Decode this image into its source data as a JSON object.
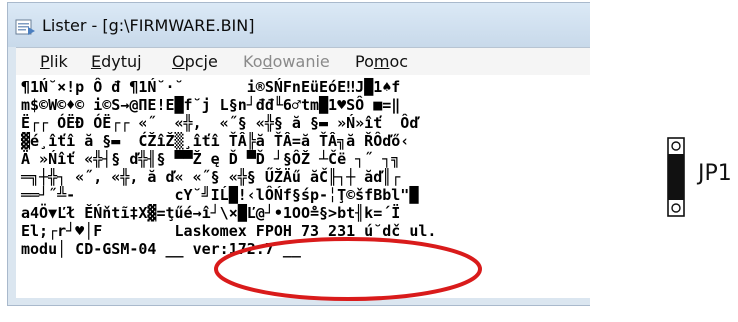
{
  "window": {
    "title": "Lister - [g:\\FIRMWARE.BIN]"
  },
  "menu": {
    "items": [
      {
        "label": "Plik",
        "enabled": true
      },
      {
        "label": "Edytuj",
        "enabled": true
      },
      {
        "label": "Opcje",
        "enabled": true
      },
      {
        "label": "Kodowanie",
        "enabled": false
      },
      {
        "label": "Pomoc",
        "enabled": true
      }
    ]
  },
  "content": {
    "lines": [
      "¶1Ń˘×!p Ô đ ¶1Ń˘·˘       i®SŃFnEüEóE‼J█1♠f",
      "m$©W©♦© i©S→@ΠE!E█f˘j L§n┘đđ╙6♂tm█1♥SÔ ■=‖",
      "Ë┌┌ ÓËĐ ÓË┌┌ «˝  «╬,  «˝§ «╬§ ă §▬ »Ń»îť  Ôď",
      "▓é¸îťî ă §▬  ĆŽîŽ▒¸îťî ŤÂ╠ă ŤÂ=ă ŤÂ╗ă ŘÔďő‹",
      "Ä »Ńîť «╬┤§ ď╬╢§ ▀▀Ž ę Ď ▀Ď ┘§ÔŽ ┴Čë ┐˝ ┐╗",
      "═╗┼╬┐ «˝, «╬, ă ď« «˝§ «╬§ ŰŽÄű ăČ╟┐┼ ăď║┌",
      "══┘˝╩-           cY˘╝IĹ█!‹lÔŃf§śp-╎Ţ©šfBbl\"█",
      "a4Ö▼Ľł ĚŃňtĩ‡X▓=ţűé→î┘\\×█Ľ@┘•1OO≗§>bt╢k=´Ϊ",
      "El;┌r┘♥│F        Laskomex FPOH 73 231 ú˘dč ul.",
      "modu│ CD-GSM-04 __ ver:172.7 __"
    ]
  },
  "annotation": {
    "circle_color": "#d91b1b"
  },
  "jumper": {
    "label": "JP1"
  }
}
